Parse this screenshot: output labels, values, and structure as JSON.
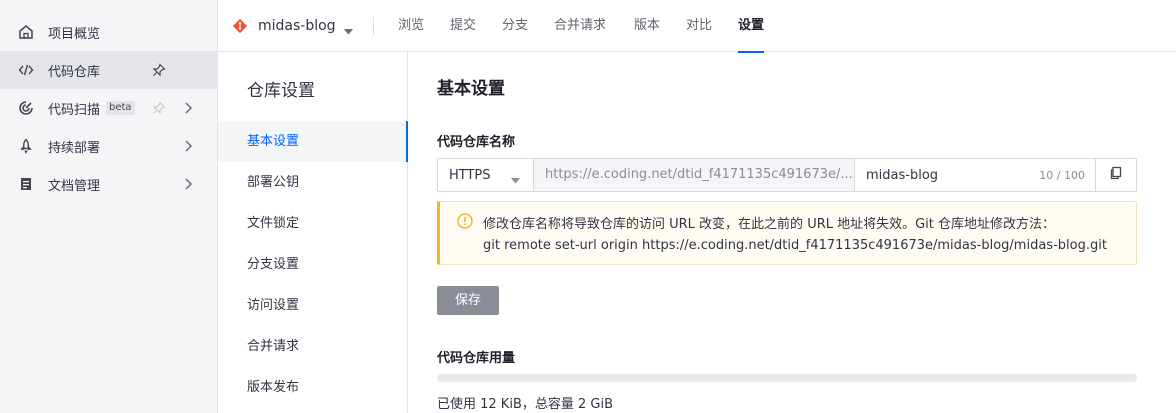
{
  "nav": {
    "items": [
      {
        "label": "项目概览",
        "icon": "home-icon"
      },
      {
        "label": "代码仓库",
        "icon": "code-icon",
        "pinned": true
      },
      {
        "label": "代码扫描",
        "icon": "scan-icon",
        "badge": "beta",
        "pinned": false
      },
      {
        "label": "持续部署",
        "icon": "rocket-icon"
      },
      {
        "label": "文档管理",
        "icon": "document-icon"
      }
    ]
  },
  "topbar": {
    "repo_name": "midas-blog",
    "tabs": [
      "浏览",
      "提交",
      "分支",
      "合并请求",
      "版本",
      "对比",
      "设置"
    ],
    "active_tab": "设置"
  },
  "settings_menu": {
    "title": "仓库设置",
    "items": [
      "基本设置",
      "部署公钥",
      "文件锁定",
      "分支设置",
      "访问设置",
      "合并请求",
      "版本发布"
    ],
    "active": "基本设置"
  },
  "main": {
    "title": "基本设置",
    "repo_name_label": "代码仓库名称",
    "protocol": "HTTPS",
    "url_prefix": "https://e.coding.net/dtid_f4171135c491673e/...",
    "repo_name_value": "midas-blog",
    "char_count": "10 / 100",
    "warning_line1": "修改仓库名称将导致仓库的访问 URL 改变，在此之前的 URL 地址将失效。Git 仓库地址修改方法：",
    "warning_line2": "git remote set-url origin https://e.coding.net/dtid_f4171135c491673e/midas-blog/midas-blog.git",
    "save_label": "保存",
    "usage_label": "代码仓库用量",
    "usage_text": "已使用 12 KiB，总容量 2 GiB",
    "usage_fraction": 0.0
  },
  "colors": {
    "accent": "#0066ff",
    "warning": "#f5b625",
    "git_logo": "#f05033"
  }
}
